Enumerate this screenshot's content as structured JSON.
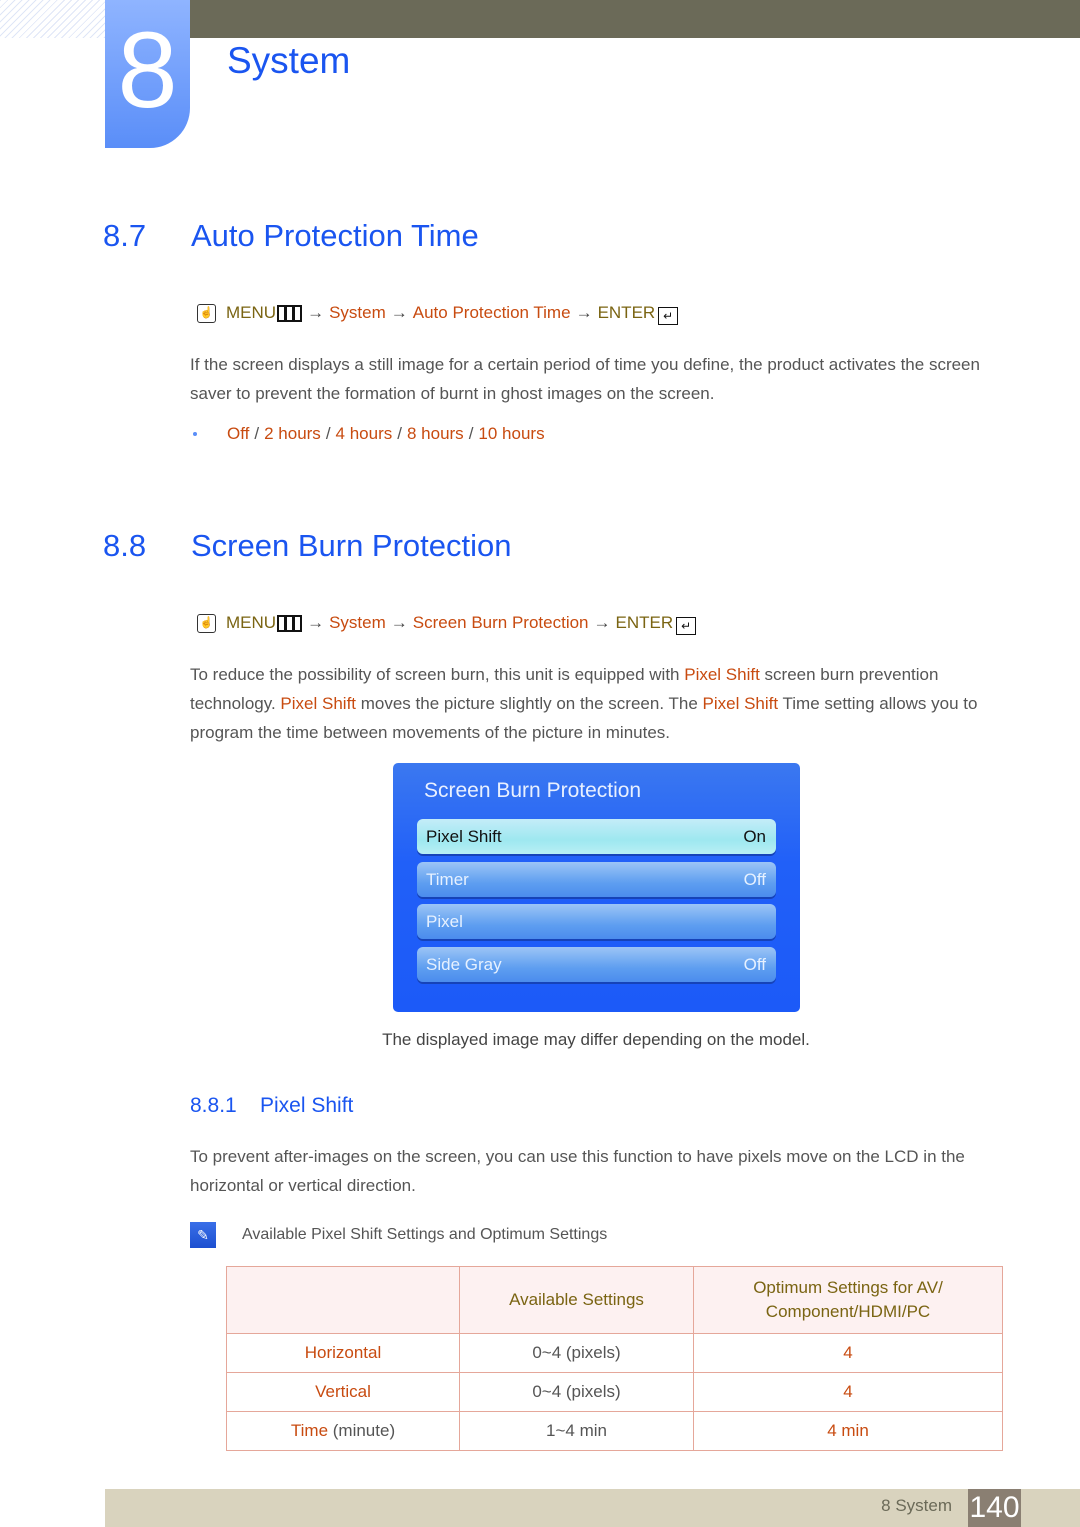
{
  "chapter": {
    "number": "8",
    "title": "System"
  },
  "section_87": {
    "number": "8.7",
    "title": "Auto Protection Time",
    "path": {
      "menu": "MENU",
      "items": [
        "System",
        "Auto Protection Time"
      ],
      "enter": "ENTER",
      "arrow": "→"
    },
    "description": "If the screen displays a still image for a certain period of time you define, the product activates the screen saver to prevent the formation of burnt in ghost images on the screen.",
    "options": [
      "Off",
      "2 hours",
      "4 hours",
      "8 hours",
      "10 hours"
    ],
    "separator": "/"
  },
  "section_88": {
    "number": "8.8",
    "title": "Screen Burn Protection",
    "path": {
      "menu": "MENU",
      "items": [
        "System",
        "Screen Burn Protection"
      ],
      "enter": "ENTER",
      "arrow": "→"
    },
    "desc_parts": [
      "To reduce the possibility of screen burn, this unit is equipped with ",
      "Pixel Shift",
      " screen burn prevention technology. ",
      "Pixel Shift",
      " moves the picture slightly on the screen. The ",
      "Pixel Shift",
      " Time setting allows you to program the time between movements of the picture in minutes."
    ],
    "osd": {
      "title": "Screen Burn Protection",
      "rows": [
        {
          "label": "Pixel Shift",
          "value": "On",
          "selected": true
        },
        {
          "label": "Timer",
          "value": "Off"
        },
        {
          "label": "Pixel",
          "value": ""
        },
        {
          "label": "Side Gray",
          "value": "Off"
        }
      ]
    },
    "caption": "The displayed image may differ depending on the model."
  },
  "section_881": {
    "number": "8.8.1",
    "title": "Pixel Shift",
    "description": "To prevent after-images on the screen, you can use this function to have pixels move on the LCD in the horizontal or vertical direction.",
    "note": "Available Pixel Shift Settings and Optimum Settings",
    "table": {
      "headers": [
        "",
        "Available Settings",
        "Optimum Settings for AV/ Component/HDMI/PC"
      ],
      "rows": [
        {
          "label": "Horizontal",
          "suffix": "",
          "available": "0~4 (pixels)",
          "optimum": "4"
        },
        {
          "label": "Vertical",
          "suffix": "",
          "available": "0~4 (pixels)",
          "optimum": "4"
        },
        {
          "label": "Time",
          "suffix": " (minute)",
          "available": "1~4 min",
          "optimum": "4 min"
        }
      ]
    }
  },
  "footer": {
    "label": "8 System",
    "page": "140"
  }
}
